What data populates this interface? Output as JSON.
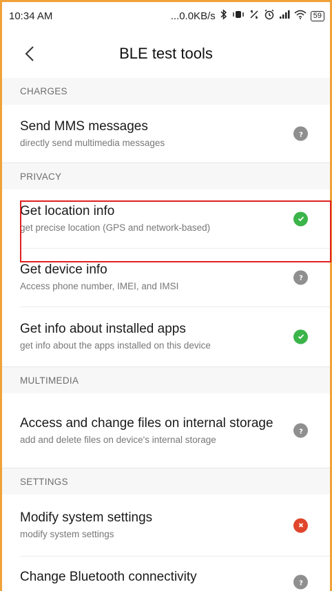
{
  "status_bar": {
    "time": "10:34 AM",
    "net_speed": "...0.0KB/s",
    "battery": "59",
    "icons": [
      "bluetooth-icon",
      "vibrate-icon",
      "data-icon",
      "alarm-icon",
      "signal-icon",
      "wifi-icon",
      "battery-icon"
    ]
  },
  "app_bar": {
    "title": "BLE test tools",
    "back_icon": "back-icon"
  },
  "sections": [
    {
      "header": "CHARGES",
      "items": [
        {
          "title": "Send MMS messages",
          "subtitle": "directly send multimedia messages",
          "status": "unknown"
        }
      ]
    },
    {
      "header": "PRIVACY",
      "items": [
        {
          "title": "Get location info",
          "subtitle": "get precise location (GPS and network-based)",
          "status": "granted"
        },
        {
          "title": "Get device info",
          "subtitle": "Access phone number, IMEI, and IMSI",
          "status": "unknown"
        },
        {
          "title": "Get info about installed apps",
          "subtitle": "get info about the apps installed on this device",
          "status": "granted"
        }
      ]
    },
    {
      "header": "MULTIMEDIA",
      "items": [
        {
          "title": "Access and change files on internal storage",
          "subtitle": "add and delete files on device's internal storage",
          "status": "unknown"
        }
      ]
    },
    {
      "header": "SETTINGS",
      "items": [
        {
          "title": "Modify system settings",
          "subtitle": "modify system settings",
          "status": "denied"
        },
        {
          "title": "Change Bluetooth connectivity",
          "subtitle": "",
          "status": "unknown"
        }
      ]
    }
  ],
  "colors": {
    "granted": "#3bb44a",
    "unknown": "#8f8f8f",
    "denied": "#e0462d",
    "highlight": "#e02020",
    "frame": "#f0a23a"
  }
}
